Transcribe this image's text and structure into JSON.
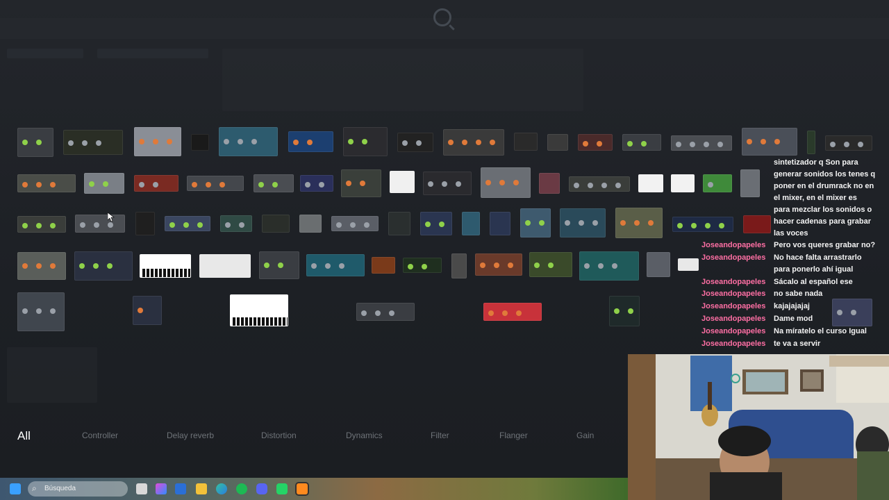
{
  "app": {
    "title": "FL Studio"
  },
  "plugin_categories": [
    {
      "label": "All",
      "active": true
    },
    {
      "label": "Controller",
      "active": false
    },
    {
      "label": "Delay reverb",
      "active": false
    },
    {
      "label": "Distortion",
      "active": false
    },
    {
      "label": "Dynamics",
      "active": false
    },
    {
      "label": "Filter",
      "active": false
    },
    {
      "label": "Flanger",
      "active": false
    },
    {
      "label": "Gain",
      "active": false
    }
  ],
  "chat": {
    "lines": [
      {
        "user": "",
        "message": "sintetizador q Son para"
      },
      {
        "user": "",
        "message": "generar sonidos los tenes q"
      },
      {
        "user": "",
        "message": "poner en el drumrack no en"
      },
      {
        "user": "",
        "message": "el mixer, en el mixer es"
      },
      {
        "user": "",
        "message": "para mezclar los sonidos o"
      },
      {
        "user": "",
        "message": "hacer cadenas para grabar"
      },
      {
        "user": "",
        "message": "las voces"
      },
      {
        "user": "Joseandopapeles",
        "message": "Pero vos queres grabar no?"
      },
      {
        "user": "Joseandopapeles",
        "message": "No hace falta arrastrarlo"
      },
      {
        "user": "",
        "message": "para ponerlo ahí igual"
      },
      {
        "user": "Joseandopapeles",
        "message": "Sácalo al español ese"
      },
      {
        "user": "Joseandopapeles",
        "message": "no sabe nada"
      },
      {
        "user": "Joseandopapeles",
        "message": "kajajajajaj"
      },
      {
        "user": "Joseandopapeles",
        "message": "Dame mod"
      },
      {
        "user": "Joseandopapeles",
        "message": "Na míratelo el curso Igual"
      },
      {
        "user": "Joseandopapeles",
        "message": "te va a servir"
      }
    ]
  },
  "taskbar": {
    "search_placeholder": "Búsqueda",
    "icons": [
      "windows-start-icon",
      "search-icon",
      "task-view-icon",
      "copilot-icon",
      "store-icon",
      "file-explorer-icon",
      "edge-icon",
      "spotify-icon",
      "discord-icon",
      "whatsapp-icon",
      "fl-studio-icon"
    ]
  },
  "colors": {
    "accent_user": "#ff6fa4",
    "background": "#1f2227",
    "category_text": "#6f7379"
  }
}
